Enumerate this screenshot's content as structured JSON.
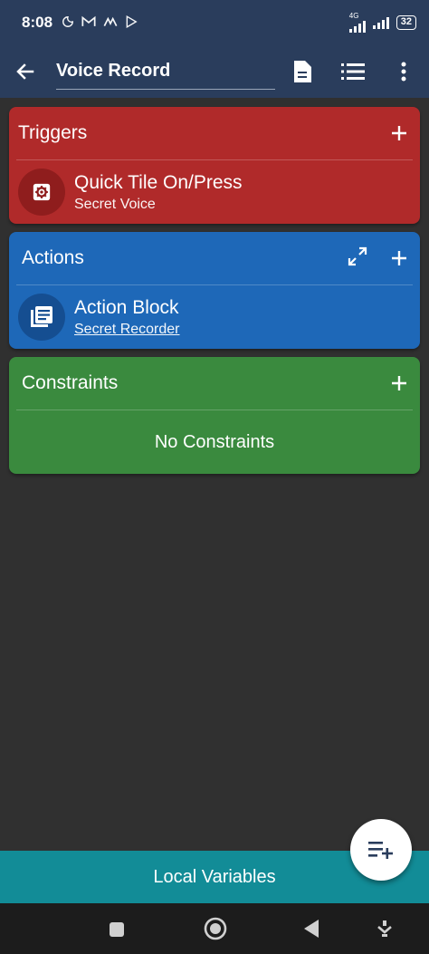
{
  "status_bar": {
    "time": "8:08",
    "network_label": "4G",
    "battery": "32"
  },
  "toolbar": {
    "title": "Voice Record"
  },
  "triggers": {
    "title": "Triggers",
    "color": "#b02a2a",
    "items": [
      {
        "title": "Quick Tile On/Press",
        "subtitle": "Secret Voice",
        "icon": "gear-icon"
      }
    ]
  },
  "actions": {
    "title": "Actions",
    "color": "#1e68b8",
    "items": [
      {
        "title": "Action Block",
        "subtitle": "Secret Recorder",
        "icon": "action-block-icon"
      }
    ]
  },
  "constraints": {
    "title": "Constraints",
    "color": "#3a8a3e",
    "empty_text": "No Constraints"
  },
  "bottom": {
    "local_variables": "Local Variables"
  }
}
